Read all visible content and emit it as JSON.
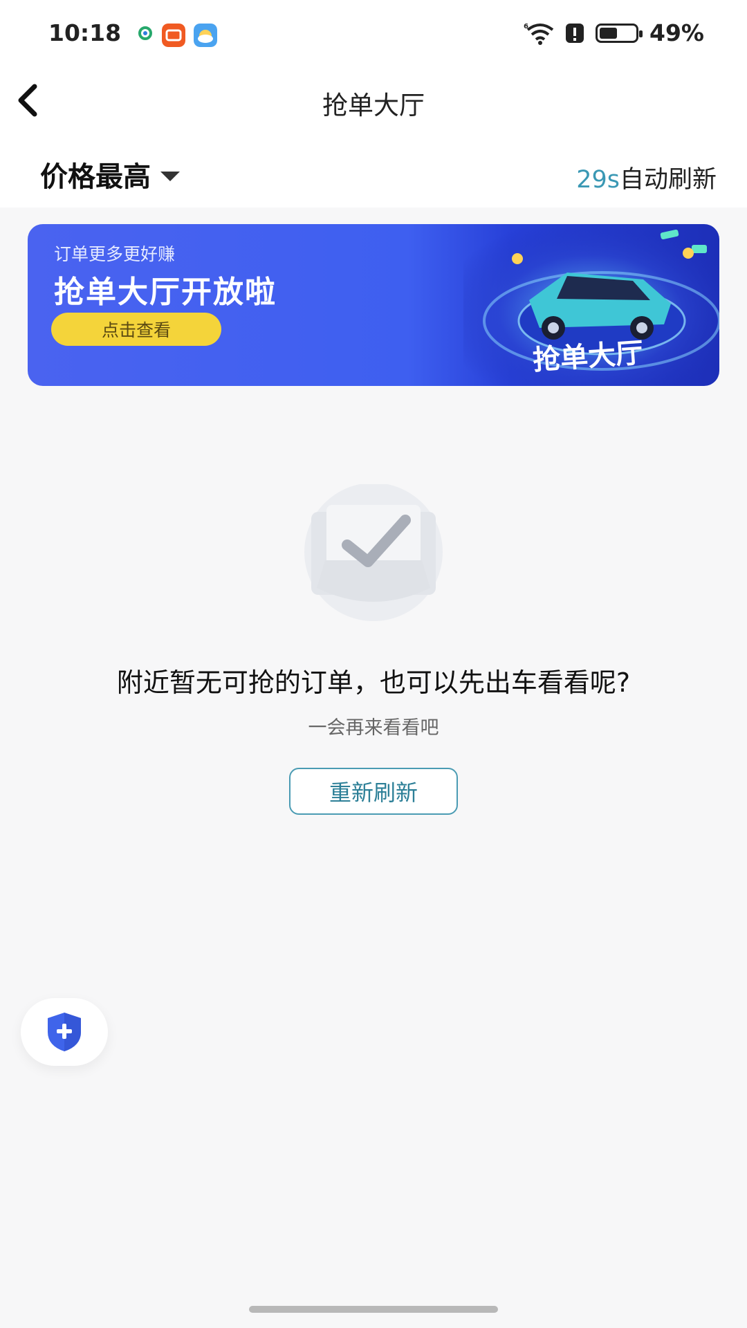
{
  "status_bar": {
    "time": "10:18",
    "battery": "49%",
    "icons": [
      "location-pin-icon",
      "taobao-app-icon",
      "weather-app-icon",
      "wifi-icon",
      "alert-icon",
      "battery-icon"
    ]
  },
  "header": {
    "title": "抢单大厅",
    "back_icon": "chevron-left-icon"
  },
  "filter": {
    "sort_label": "价格最高",
    "refresh_seconds": "29s",
    "refresh_suffix": "自动刷新"
  },
  "banner": {
    "subtitle": "订单更多更好赚",
    "title": "抢单大厅开放啦",
    "cta": "点击查看",
    "badge_text": "抢单大厅"
  },
  "empty_state": {
    "message": "附近暂无可抢的订单，也可以先出车看看呢?",
    "sub_message": "一会再来看看吧",
    "button": "重新刷新"
  },
  "colors": {
    "accent": "#3a98b4",
    "banner_blue": "#3e5ff0",
    "cta_yellow": "#f4d43a",
    "shield_blue": "#3f64ea"
  }
}
